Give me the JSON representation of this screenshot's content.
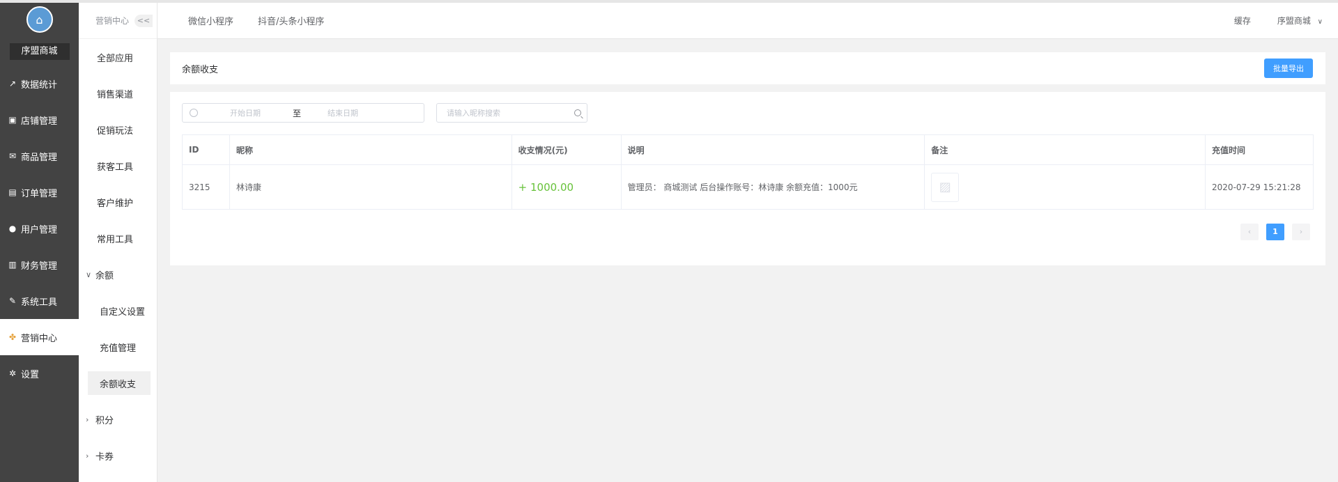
{
  "sidebar": {
    "shop_name": "序盟商城",
    "items": [
      {
        "label": "数据统计",
        "icon": "chart-line-icon"
      },
      {
        "label": "店铺管理",
        "icon": "store-icon"
      },
      {
        "label": "商品管理",
        "icon": "inbox-icon"
      },
      {
        "label": "订单管理",
        "icon": "order-list-icon"
      },
      {
        "label": "用户管理",
        "icon": "user-icon"
      },
      {
        "label": "财务管理",
        "icon": "wallet-icon"
      },
      {
        "label": "系统工具",
        "icon": "wrench-icon"
      },
      {
        "label": "营销中心",
        "icon": "marketing-icon",
        "active": true
      },
      {
        "label": "设置",
        "icon": "gear-icon"
      }
    ]
  },
  "submenu": {
    "header": "营销中心",
    "collapse_label": "<<",
    "items": [
      "全部应用",
      "销售渠道",
      "促销玩法",
      "获客工具",
      "客户维护",
      "常用工具"
    ],
    "group_balance": "余额",
    "balance_children": [
      "自定义设置",
      "充值管理",
      "余额收支"
    ],
    "group_points": "积分",
    "group_coupon": "卡券"
  },
  "header": {
    "tabs": [
      "微信小程序",
      "抖音/头条小程序"
    ],
    "cache": "缓存",
    "user": "序盟商城"
  },
  "page": {
    "title": "余额收支",
    "export_label": "批量导出"
  },
  "filters": {
    "start_placeholder": "开始日期",
    "separator": "至",
    "end_placeholder": "结束日期",
    "search_placeholder": "请输入昵称搜索"
  },
  "table": {
    "columns": [
      "ID",
      "昵称",
      "收支情况(元)",
      "说明",
      "备注",
      "充值时间"
    ],
    "rows": [
      {
        "id": "3215",
        "nickname": "林诗康",
        "amount": "+ 1000.00",
        "description": "管理员： 商城测试 后台操作账号：林诗康 余额充值：1000元",
        "remark": "",
        "time": "2020-07-29 15:21:28"
      }
    ]
  },
  "pagination": {
    "prev": "‹",
    "current": "1",
    "next": "›"
  },
  "colors": {
    "sidebar_bg": "#434343",
    "primary": "#409eff",
    "amount_green": "#67c23a"
  }
}
